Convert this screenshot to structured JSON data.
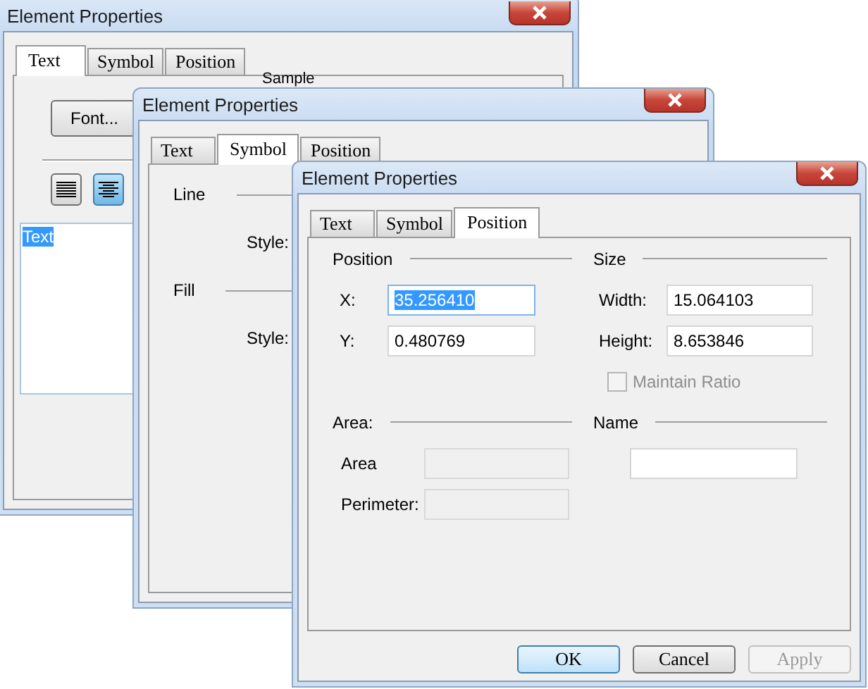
{
  "windows": [
    {
      "kind": "text",
      "title": "Element Properties",
      "tabs": [
        {
          "label": "Text",
          "selected": true
        },
        {
          "label": "Symbol",
          "selected": false
        },
        {
          "label": "Position",
          "selected": false
        }
      ],
      "font_button": "Font...",
      "sample_label": "Sample",
      "align_buttons": [
        {
          "kind": "left",
          "selected": false
        },
        {
          "kind": "center",
          "selected": true
        }
      ],
      "text_box": {
        "value": "Text",
        "selected": true
      }
    },
    {
      "kind": "symbol",
      "title": "Element Properties",
      "tabs": [
        {
          "label": "Text",
          "selected": false
        },
        {
          "label": "Symbol",
          "selected": true
        },
        {
          "label": "Position",
          "selected": false
        }
      ],
      "sections": [
        {
          "label": "Line",
          "style_label": "Style:"
        },
        {
          "label": "Fill",
          "style_label": "Style:"
        }
      ]
    },
    {
      "kind": "position",
      "title": "Element Properties",
      "tabs": [
        {
          "label": "Text",
          "selected": false
        },
        {
          "label": "Symbol",
          "selected": false
        },
        {
          "label": "Position",
          "selected": true
        }
      ],
      "groups": [
        {
          "label": "Position",
          "fields": [
            {
              "label": "X:",
              "value": "35.256410",
              "selected": true,
              "disabled": false
            },
            {
              "label": "Y:",
              "value": "0.480769",
              "selected": false,
              "disabled": false
            }
          ]
        },
        {
          "label": "Size",
          "fields": [
            {
              "label": "Width:",
              "value": "15.064103",
              "selected": false,
              "disabled": false
            },
            {
              "label": "Height:",
              "value": "8.653846",
              "selected": false,
              "disabled": false
            }
          ],
          "checkbox": {
            "label": "Maintain Ratio",
            "checked": false,
            "disabled": true
          }
        },
        {
          "label": "Area:",
          "fields": [
            {
              "label": "Area",
              "disabled": true
            },
            {
              "label": "Perimeter:",
              "disabled": true
            }
          ]
        },
        {
          "label": "Name",
          "fields": [
            {
              "selected": false,
              "disabled": false
            }
          ]
        }
      ],
      "buttons": [
        {
          "label": "OK",
          "kind": "default",
          "disabled": false
        },
        {
          "label": "Cancel",
          "kind": "normal",
          "disabled": false
        },
        {
          "label": "Apply",
          "kind": "normal",
          "disabled": true
        }
      ]
    }
  ]
}
